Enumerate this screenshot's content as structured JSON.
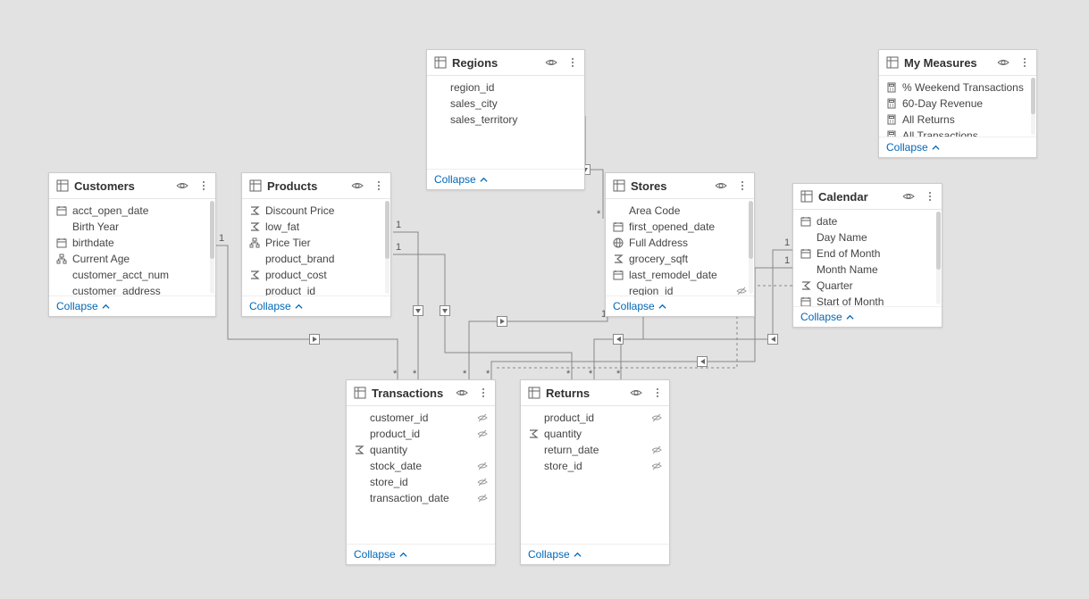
{
  "collapse_label": "Collapse",
  "tables": {
    "regions": {
      "title": "Regions",
      "fields": [
        {
          "name": "region_id"
        },
        {
          "name": "sales_city"
        },
        {
          "name": "sales_territory"
        }
      ]
    },
    "my_measures": {
      "title": "My Measures",
      "fields": [
        {
          "name": "% Weekend Transactions",
          "icon": "calc"
        },
        {
          "name": "60-Day Revenue",
          "icon": "calc"
        },
        {
          "name": "All Returns",
          "icon": "calc"
        },
        {
          "name": "All Transactions",
          "icon": "calc"
        }
      ]
    },
    "customers": {
      "title": "Customers",
      "fields": [
        {
          "name": "acct_open_date",
          "icon": "date"
        },
        {
          "name": "Birth Year"
        },
        {
          "name": "birthdate",
          "icon": "date"
        },
        {
          "name": "Current Age",
          "icon": "hier"
        },
        {
          "name": "customer_acct_num"
        },
        {
          "name": "customer_address"
        }
      ]
    },
    "products": {
      "title": "Products",
      "fields": [
        {
          "name": "Discount Price",
          "icon": "sum"
        },
        {
          "name": "low_fat",
          "icon": "sum"
        },
        {
          "name": "Price Tier",
          "icon": "hier"
        },
        {
          "name": "product_brand"
        },
        {
          "name": "product_cost",
          "icon": "sum"
        },
        {
          "name": "product_id"
        }
      ]
    },
    "stores": {
      "title": "Stores",
      "fields": [
        {
          "name": "Area Code"
        },
        {
          "name": "first_opened_date",
          "icon": "date"
        },
        {
          "name": "Full Address",
          "icon": "globe"
        },
        {
          "name": "grocery_sqft",
          "icon": "sum"
        },
        {
          "name": "last_remodel_date",
          "icon": "date"
        },
        {
          "name": "region_id",
          "hidden": true
        }
      ]
    },
    "calendar": {
      "title": "Calendar",
      "fields": [
        {
          "name": "date",
          "icon": "date"
        },
        {
          "name": "Day Name"
        },
        {
          "name": "End of Month",
          "icon": "date"
        },
        {
          "name": "Month Name"
        },
        {
          "name": "Quarter",
          "icon": "sum"
        },
        {
          "name": "Start of Month",
          "icon": "date"
        }
      ]
    },
    "transactions": {
      "title": "Transactions",
      "fields": [
        {
          "name": "customer_id",
          "hidden": true
        },
        {
          "name": "product_id",
          "hidden": true
        },
        {
          "name": "quantity",
          "icon": "sum"
        },
        {
          "name": "stock_date",
          "hidden": true
        },
        {
          "name": "store_id",
          "hidden": true
        },
        {
          "name": "transaction_date",
          "hidden": true
        }
      ]
    },
    "returns": {
      "title": "Returns",
      "fields": [
        {
          "name": "product_id",
          "hidden": true
        },
        {
          "name": "quantity",
          "icon": "sum"
        },
        {
          "name": "return_date",
          "hidden": true
        },
        {
          "name": "store_id",
          "hidden": true
        }
      ]
    }
  },
  "cardinality": {
    "regions_stores": {
      "from": "1",
      "to": "*"
    },
    "customers_transactions": {
      "from": "1",
      "to": "*"
    },
    "products_transactions": {
      "from": "1",
      "to": "*"
    },
    "products_returns": {
      "from": "1",
      "to": "*"
    },
    "stores_transactions": {
      "from": "1",
      "to": "*"
    },
    "stores_returns": {
      "from": "1",
      "to": "*"
    },
    "calendar_transactions": {
      "from": "1",
      "to": "*"
    },
    "calendar_returns": {
      "from": "1",
      "to": "*"
    },
    "calendar_transactions2": {
      "from": "1",
      "to": "*"
    }
  }
}
